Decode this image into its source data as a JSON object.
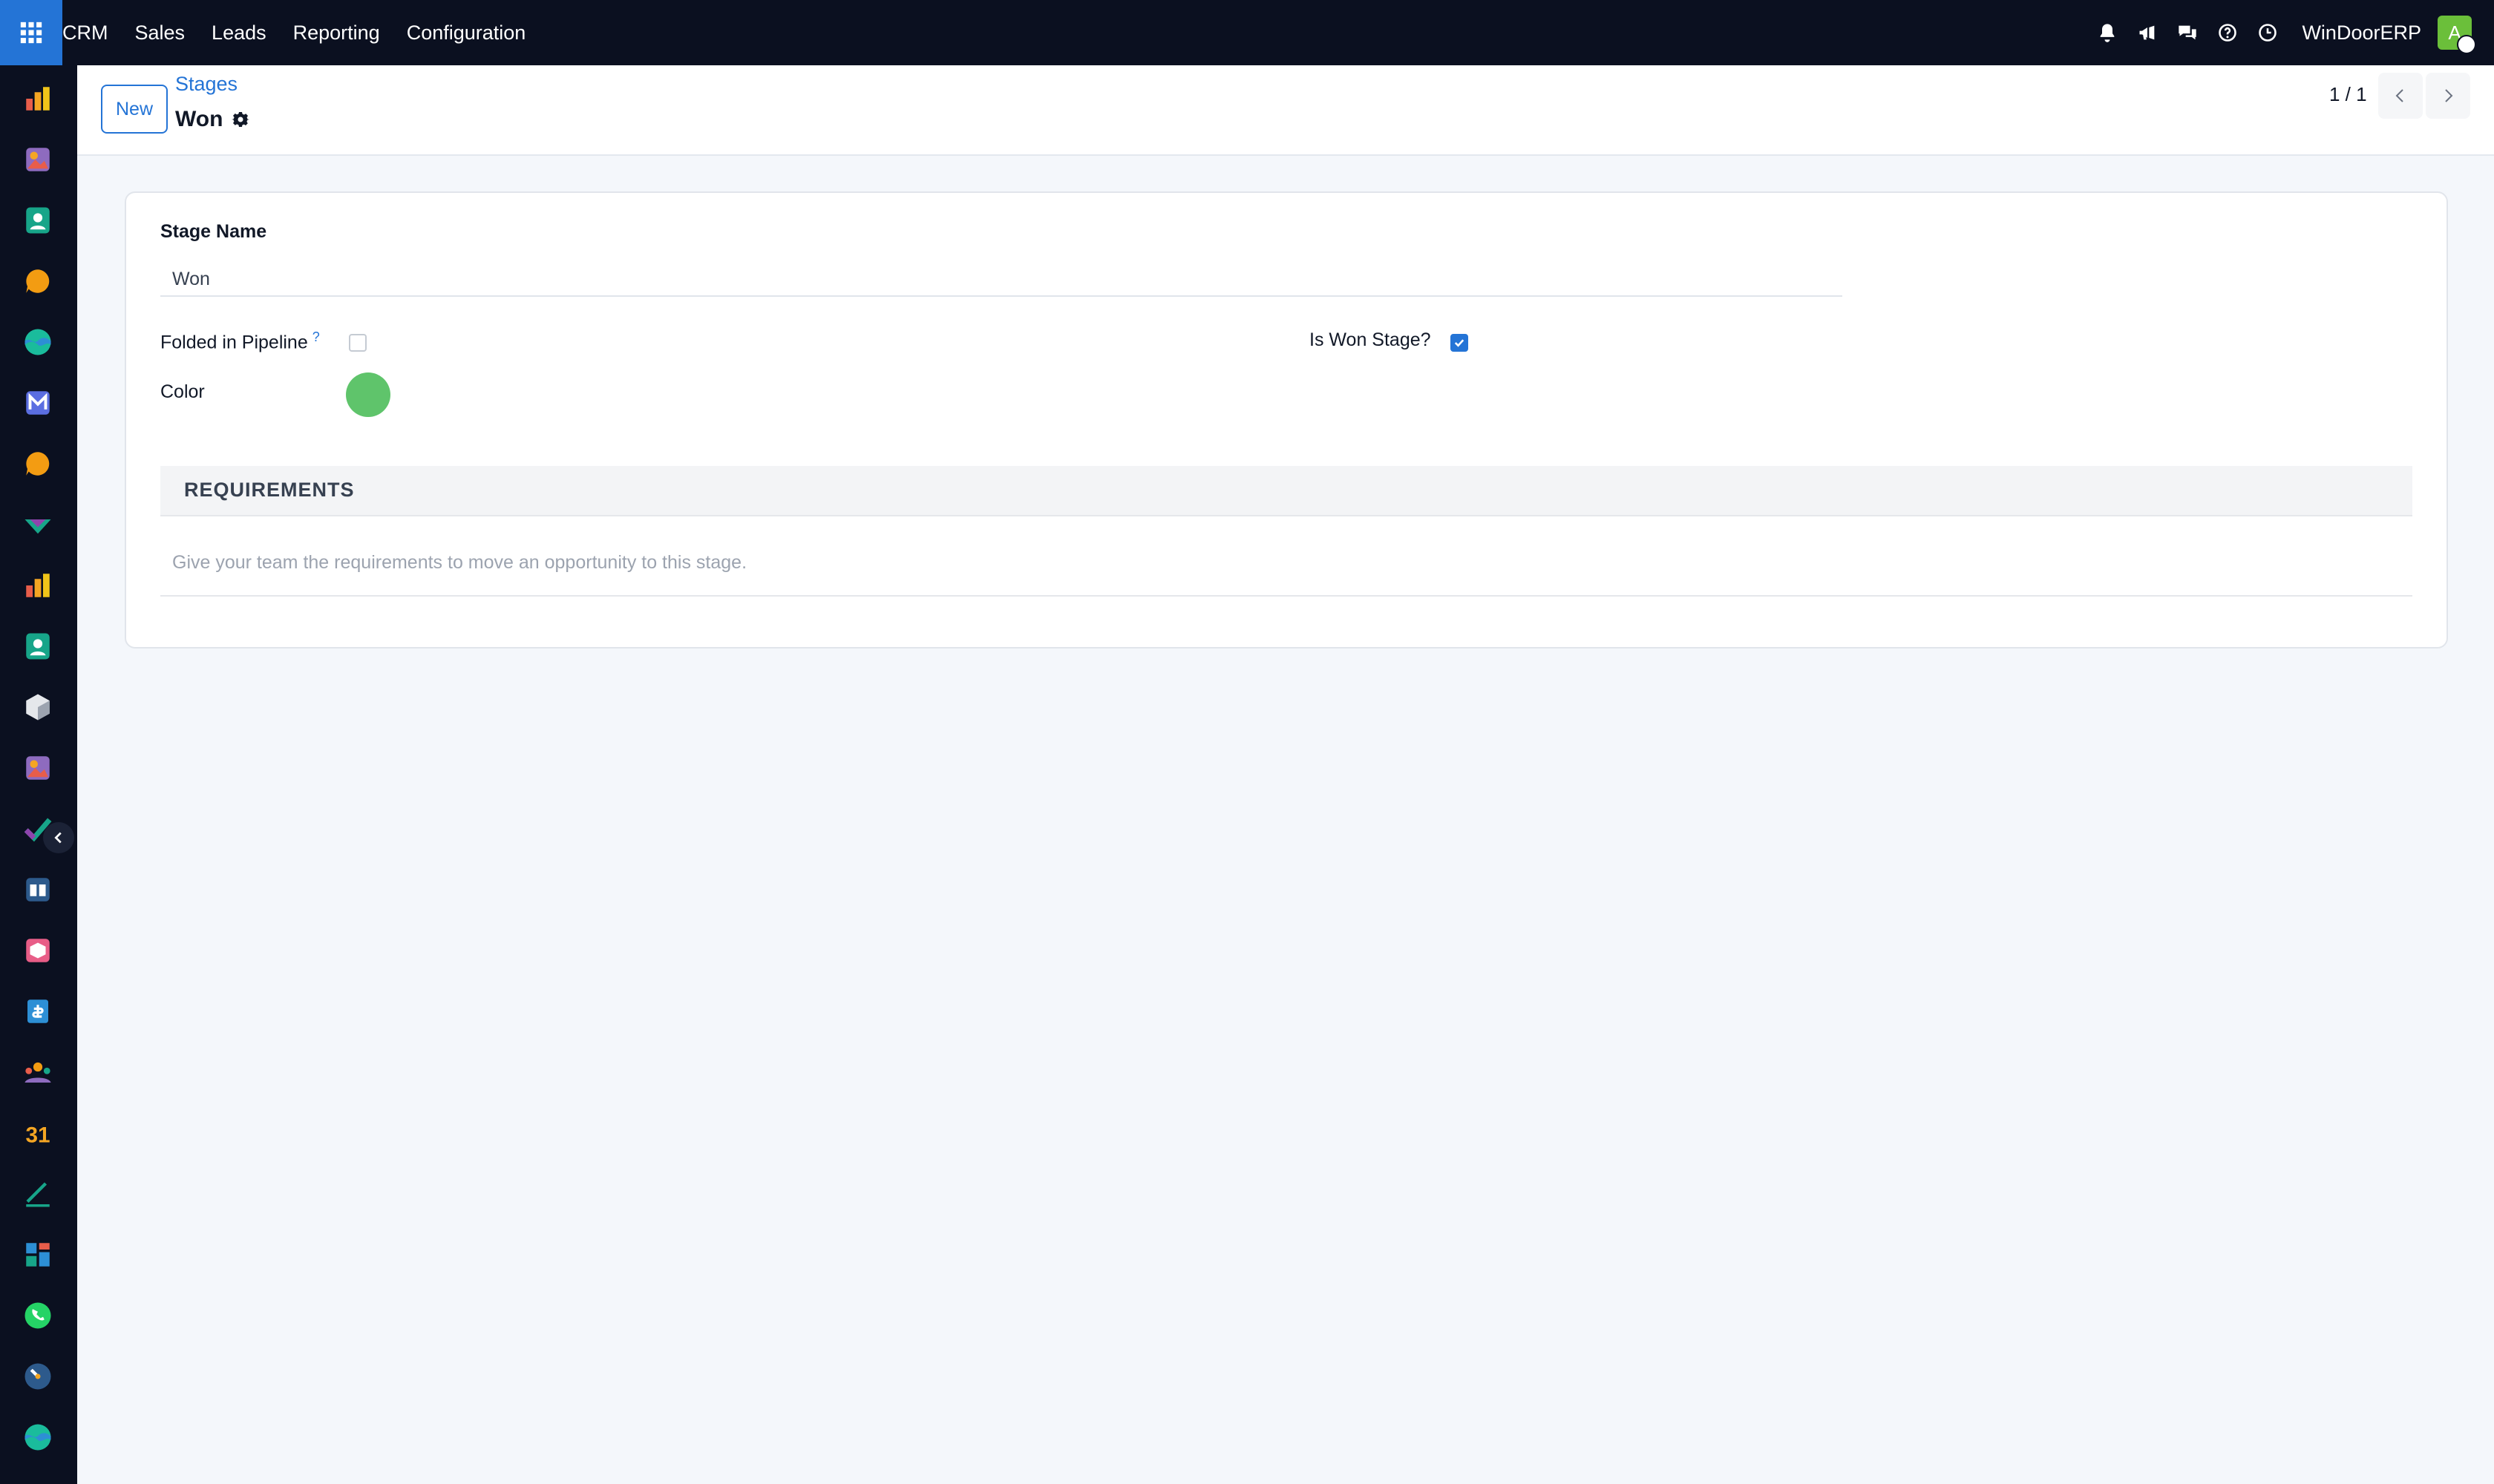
{
  "topbar": {
    "menu": [
      "CRM",
      "Sales",
      "Leads",
      "Reporting",
      "Configuration"
    ],
    "company": "WinDoorERP",
    "avatar_initial": "A"
  },
  "control_panel": {
    "new_label": "New",
    "breadcrumb": "Stages",
    "title": "Won",
    "pager": "1 / 1"
  },
  "form": {
    "stage_name_label": "Stage Name",
    "stage_name_value": "Won",
    "folded_label": "Folded in Pipeline",
    "folded_help": "?",
    "folded_checked": false,
    "is_won_label": "Is Won Stage?",
    "is_won_checked": true,
    "color_label": "Color",
    "color_value": "#5fc46b",
    "requirements_title": "REQUIREMENTS",
    "requirements_placeholder": "Give your team the requirements to move an opportunity to this stage."
  },
  "colors": {
    "topbar_bg": "#0b1020",
    "accent": "#2474d6",
    "page_bg": "#f4f7fb"
  },
  "rail_icons": [
    "bar-chart-icon",
    "photo-app-icon",
    "contacts-icon",
    "chat-bubble-icon",
    "wave-app-icon",
    "mail-marketing-icon",
    "chat-bubble-icon",
    "check-mark-app-icon",
    "bar-chart-icon",
    "contacts-icon",
    "cube-icon",
    "photo-app-icon",
    "project-check-icon",
    "knowledge-book-icon",
    "package-icon",
    "invoice-icon",
    "team-icon",
    "calendar-icon",
    "sign-pen-icon",
    "dashboard-icon",
    "whatsapp-icon",
    "clock-app-icon",
    "wave-app-icon"
  ]
}
